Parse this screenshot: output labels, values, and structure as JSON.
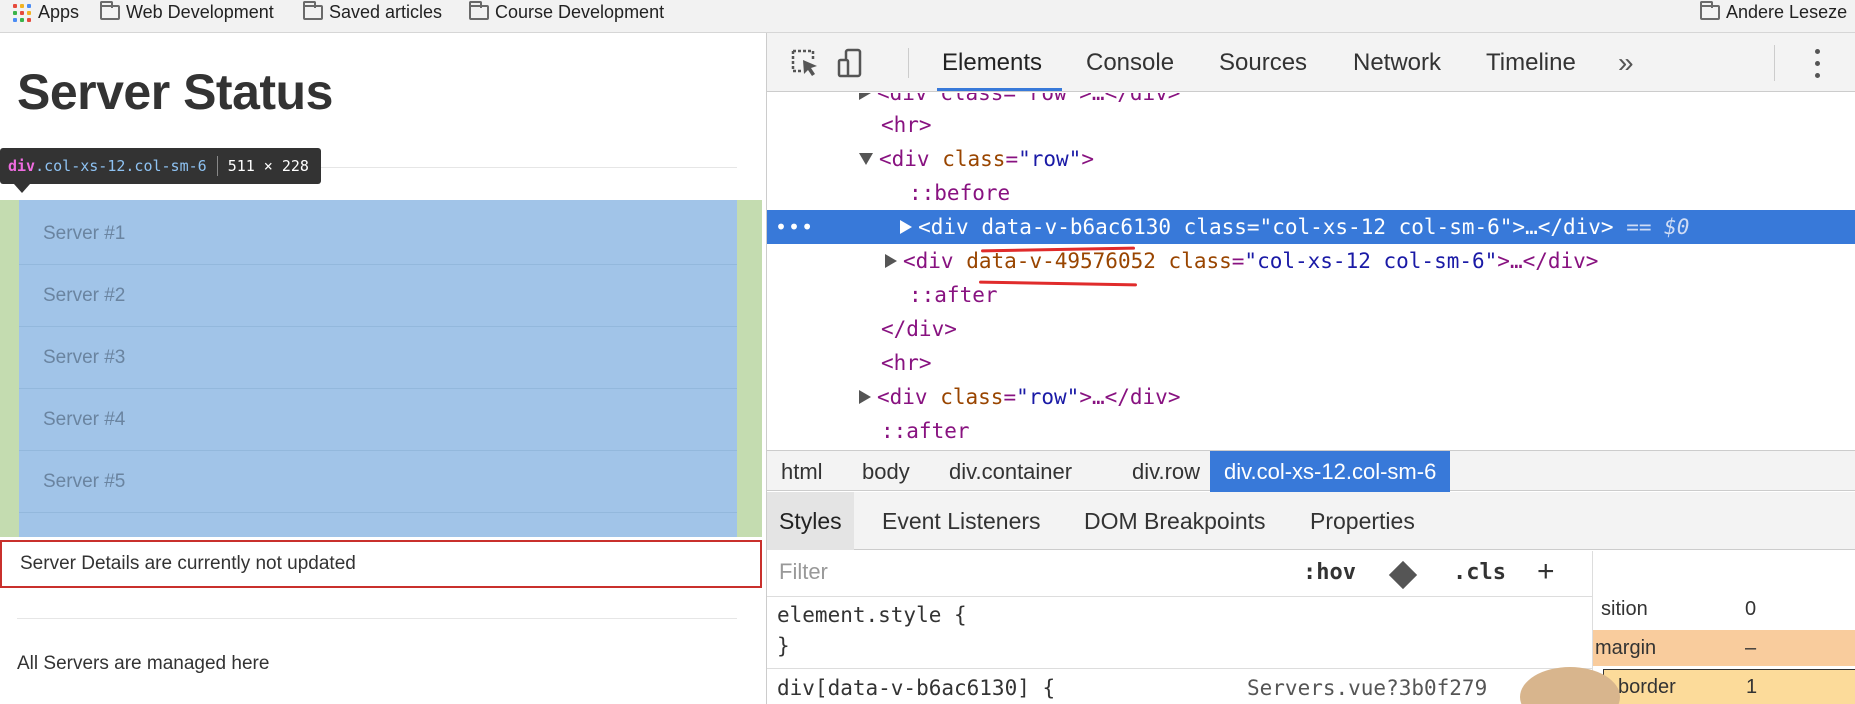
{
  "bookmarks": {
    "apps": "Apps",
    "items": [
      "Web Development",
      "Saved articles",
      "Course Development"
    ],
    "right": "Andere Leseze"
  },
  "page": {
    "title": "Server Status",
    "tooltip": {
      "tag": "div",
      "classes": ".col-xs-12.col-sm-6",
      "dims": "511 × 228"
    },
    "servers": [
      "Server #1",
      "Server #2",
      "Server #3",
      "Server #4",
      "Server #5"
    ],
    "details": "Server Details are currently not updated",
    "managed": "All Servers are managed here"
  },
  "devtools": {
    "tabs": [
      "Elements",
      "Console",
      "Sources",
      "Network",
      "Timeline"
    ],
    "more": "»",
    "dom": {
      "l0": "<div class=\"row\">…</div>",
      "l1": "<hr>",
      "l2_tag": "<div",
      "l2_attr": "class",
      "l2_val": "\"row\"",
      "l3": "::before",
      "l4_tag": "<div",
      "l4_attr1": "data-v-b6ac6130",
      "l4_attr2": "class",
      "l4_val": "\"col-xs-12 col-sm-6\"",
      "l4_end": ">…</div>",
      "l4_eq": "== $0",
      "l5_tag": "<div",
      "l5_attr1": "data-v-49576052",
      "l5_attr2": "class",
      "l5_val": "\"col-xs-12 col-sm-6\"",
      "l5_end": ">…</div>",
      "l6": "::after",
      "l7": "</div>",
      "l8": "<hr>",
      "l9_tag": "<div",
      "l9_attr": "class",
      "l9_val": "\"row\"",
      "l9_end": ">…</div>",
      "l10": "::after",
      "dots": "•••"
    },
    "breadcrumbs": [
      "html",
      "body",
      "div.container",
      "div.row",
      "div.col-xs-12.col-sm-6"
    ],
    "style_tabs": [
      "Styles",
      "Event Listeners",
      "DOM Breakpoints",
      "Properties"
    ],
    "filter_placeholder": "Filter",
    "hov": ":hov",
    "cls": ".cls",
    "plus": "+",
    "rules": {
      "element_style": "element.style {",
      "close": "}",
      "next_rule": "div[data-v-b6ac6130] {",
      "source": "Servers.vue?3b0f279"
    },
    "computed": {
      "position_label": "sition",
      "position_value": "0",
      "margin_label": "margin",
      "margin_value": "–",
      "border_label": "border",
      "border_value": "1"
    }
  },
  "colors": {
    "accent": "#3879d9",
    "padding": "#c4dcb0",
    "content": "#a1c4e8",
    "highlight_border": "#c9302c"
  }
}
